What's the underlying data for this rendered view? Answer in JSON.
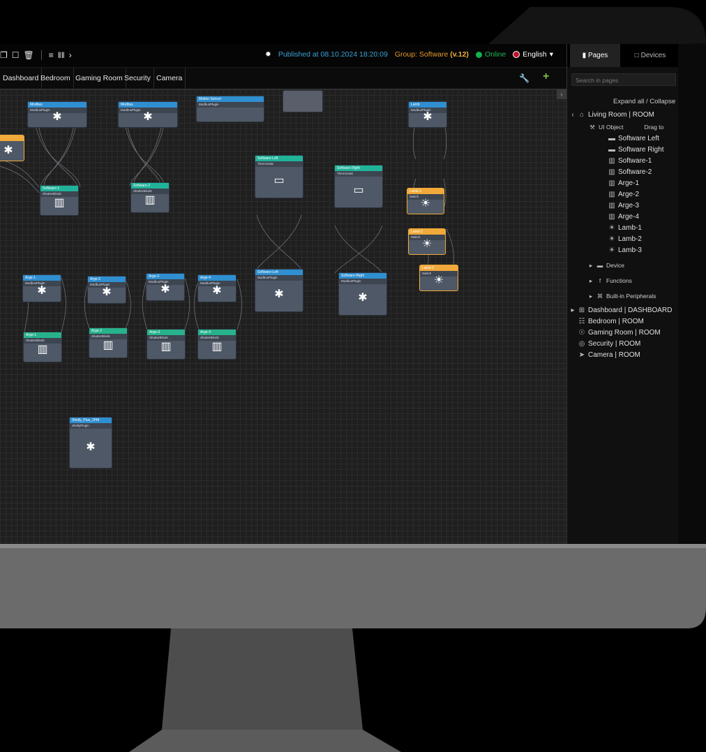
{
  "toolbar": {
    "published": "Published at 08.10.2024 18:20:09",
    "group_prefix": "Group: Software",
    "group_version": "(v.12)",
    "online": "Online",
    "language": "English"
  },
  "tabs": [
    "Dashboard",
    "Bedroom",
    "Gaming Room",
    "Security",
    "Camera"
  ],
  "sidebar": {
    "tab_pages": "Pages",
    "tab_devices": "Devices",
    "search_placeholder": "Search in pages",
    "expand_collapse": "Expand all  /  Collapse",
    "living_room": "Living Room | ROOM",
    "ui_object": "UI Object",
    "drag_hint": "Drag to",
    "items": [
      "Software Left",
      "Software Right",
      "Software-1",
      "Software-2",
      "Arge-1",
      "Arge-2",
      "Arge-3",
      "Arge-4",
      "Lamb-1",
      "Lamb-2",
      "Lamb-3"
    ],
    "device": "Device",
    "functions": "Functions",
    "builtin": "Built-in Peripherals",
    "pages": [
      "Dashboard | DASHBOARD",
      "Bedroom | ROOM",
      "Gaming Room | ROOM",
      "Security | ROOM",
      "Camera | ROOM"
    ]
  },
  "nodes": {
    "modbus1": {
      "title": "Modbus",
      "sub": "ModbusPlugin"
    },
    "modbus2": {
      "title": "Modbus",
      "sub": "ModbusPlugin"
    },
    "motion": {
      "title": "Motion Sensor",
      "sub": "ModbusPlugin"
    },
    "lamb": {
      "title": "Lamb",
      "sub": "ModbusPlugin"
    },
    "soft1": {
      "title": "Software-1",
      "sub": "ShutterBlinds"
    },
    "soft2": {
      "title": "Software-2",
      "sub": "ShutterBlinds"
    },
    "softleft": {
      "title": "Software Left",
      "sub": "Thermostat"
    },
    "softright": {
      "title": "Software Right",
      "sub": "Thermostat"
    },
    "softleft2": {
      "title": "Software-Left",
      "sub": "ModbusPlugin"
    },
    "softright2": {
      "title": "Software-Right",
      "sub": "ModbusPlugin"
    },
    "lamb1": {
      "title": "Lamb-1",
      "sub": "Switch"
    },
    "lamb2": {
      "title": "Lamb-2",
      "sub": "Switch"
    },
    "lamb3": {
      "title": "Lamb-3",
      "sub": "Switch"
    },
    "arge1m": {
      "title": "Arge-1",
      "sub": "ModbusPlugin"
    },
    "arge2m": {
      "title": "Arge-2",
      "sub": "ModbusPlugin"
    },
    "arge3m": {
      "title": "Arge-3",
      "sub": "ModbusPlugin"
    },
    "arge4m": {
      "title": "Arge-4",
      "sub": "ModbusPlugin"
    },
    "arge1s": {
      "title": "Arge-1",
      "sub": "ShutterBlinds"
    },
    "arge2s": {
      "title": "Arge-2",
      "sub": "ShutterBlinds"
    },
    "arge3s": {
      "title": "Arge-3",
      "sub": "ShutterBlinds"
    },
    "arge4s": {
      "title": "Arge-4",
      "sub": "ShutterBlinds"
    },
    "shelly": {
      "title": "Shelly_Plus_1PM",
      "sub": "ShellyPlugin"
    }
  },
  "colors": {
    "accent_blue": "#2f8fd0",
    "teal": "#20b39a",
    "yellow": "#f0a93a",
    "online_green": "#15b04a",
    "group_orange": "#e59a2b"
  }
}
